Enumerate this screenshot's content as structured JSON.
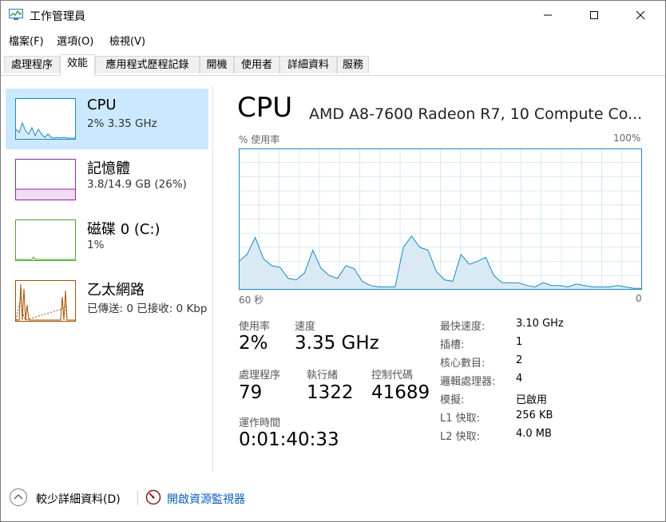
{
  "window": {
    "title": "工作管理員"
  },
  "menu": [
    {
      "label": "檔案(F)"
    },
    {
      "label": "選項(O)"
    },
    {
      "label": "檢視(V)"
    }
  ],
  "tabs": [
    {
      "label": "處理程序"
    },
    {
      "label": "效能",
      "active": true
    },
    {
      "label": "應用程式歷程記錄"
    },
    {
      "label": "開機"
    },
    {
      "label": "使用者"
    },
    {
      "label": "詳細資料"
    },
    {
      "label": "服務"
    }
  ],
  "sidebar": {
    "items": [
      {
        "title": "CPU",
        "subtitle": "2% 3.35 GHz",
        "color": "#1a8abd"
      },
      {
        "title": "記憶體",
        "subtitle": "3.8/14.9 GB (26%)",
        "color": "#8b2a9b"
      },
      {
        "title": "磁碟 0 (C:)",
        "subtitle": "1%",
        "color": "#4fa32b"
      },
      {
        "title": "乙太網路",
        "subtitle": "已傳送: 0 已接收: 0 Kbp",
        "color": "#a74f01"
      }
    ]
  },
  "main": {
    "title": "CPU",
    "model": "AMD A8-7600 Radeon R7, 10 Compute Co...",
    "graph": {
      "y_label": "% 使用率",
      "y_max_label": "100%",
      "x_left_label": "60 秒",
      "x_right_label": "0",
      "line_color": "#1a8abd",
      "fill_color": "#d9eaf5",
      "grid_color": "#d8e9f2",
      "usage": [
        20,
        25,
        37,
        22,
        17,
        16,
        8,
        7,
        12,
        28,
        15,
        10,
        8,
        17,
        15,
        6,
        3,
        2,
        2,
        2,
        30,
        38,
        30,
        28,
        13,
        7,
        6,
        25,
        18,
        20,
        23,
        10,
        5,
        5,
        5,
        3,
        2,
        5,
        3,
        3,
        2,
        4,
        3,
        2,
        2,
        2,
        3,
        2,
        1,
        1
      ]
    },
    "stats": {
      "usage_label": "使用率",
      "usage_value": "2%",
      "speed_label": "速度",
      "speed_value": "3.35 GHz",
      "processes_label": "處理程序",
      "processes_value": "79",
      "threads_label": "執行緒",
      "threads_value": "1322",
      "handles_label": "控制代碼",
      "handles_value": "41689",
      "uptime_label": "運作時間",
      "uptime_value": "0:01:40:33"
    },
    "specs": [
      {
        "key": "最快速度:",
        "value": "3.10 GHz"
      },
      {
        "key": "插槽:",
        "value": "1"
      },
      {
        "key": "核心數目:",
        "value": "2"
      },
      {
        "key": "邏輯處理器:",
        "value": "4"
      },
      {
        "key": "模擬:",
        "value": "已啟用"
      },
      {
        "key": "L1 快取:",
        "value": "256 KB"
      },
      {
        "key": "L2 快取:",
        "value": "4.0 MB"
      }
    ]
  },
  "footer": {
    "fewer_details": "較少詳細資料(D)",
    "resource_monitor": "開啟資源監視器"
  }
}
